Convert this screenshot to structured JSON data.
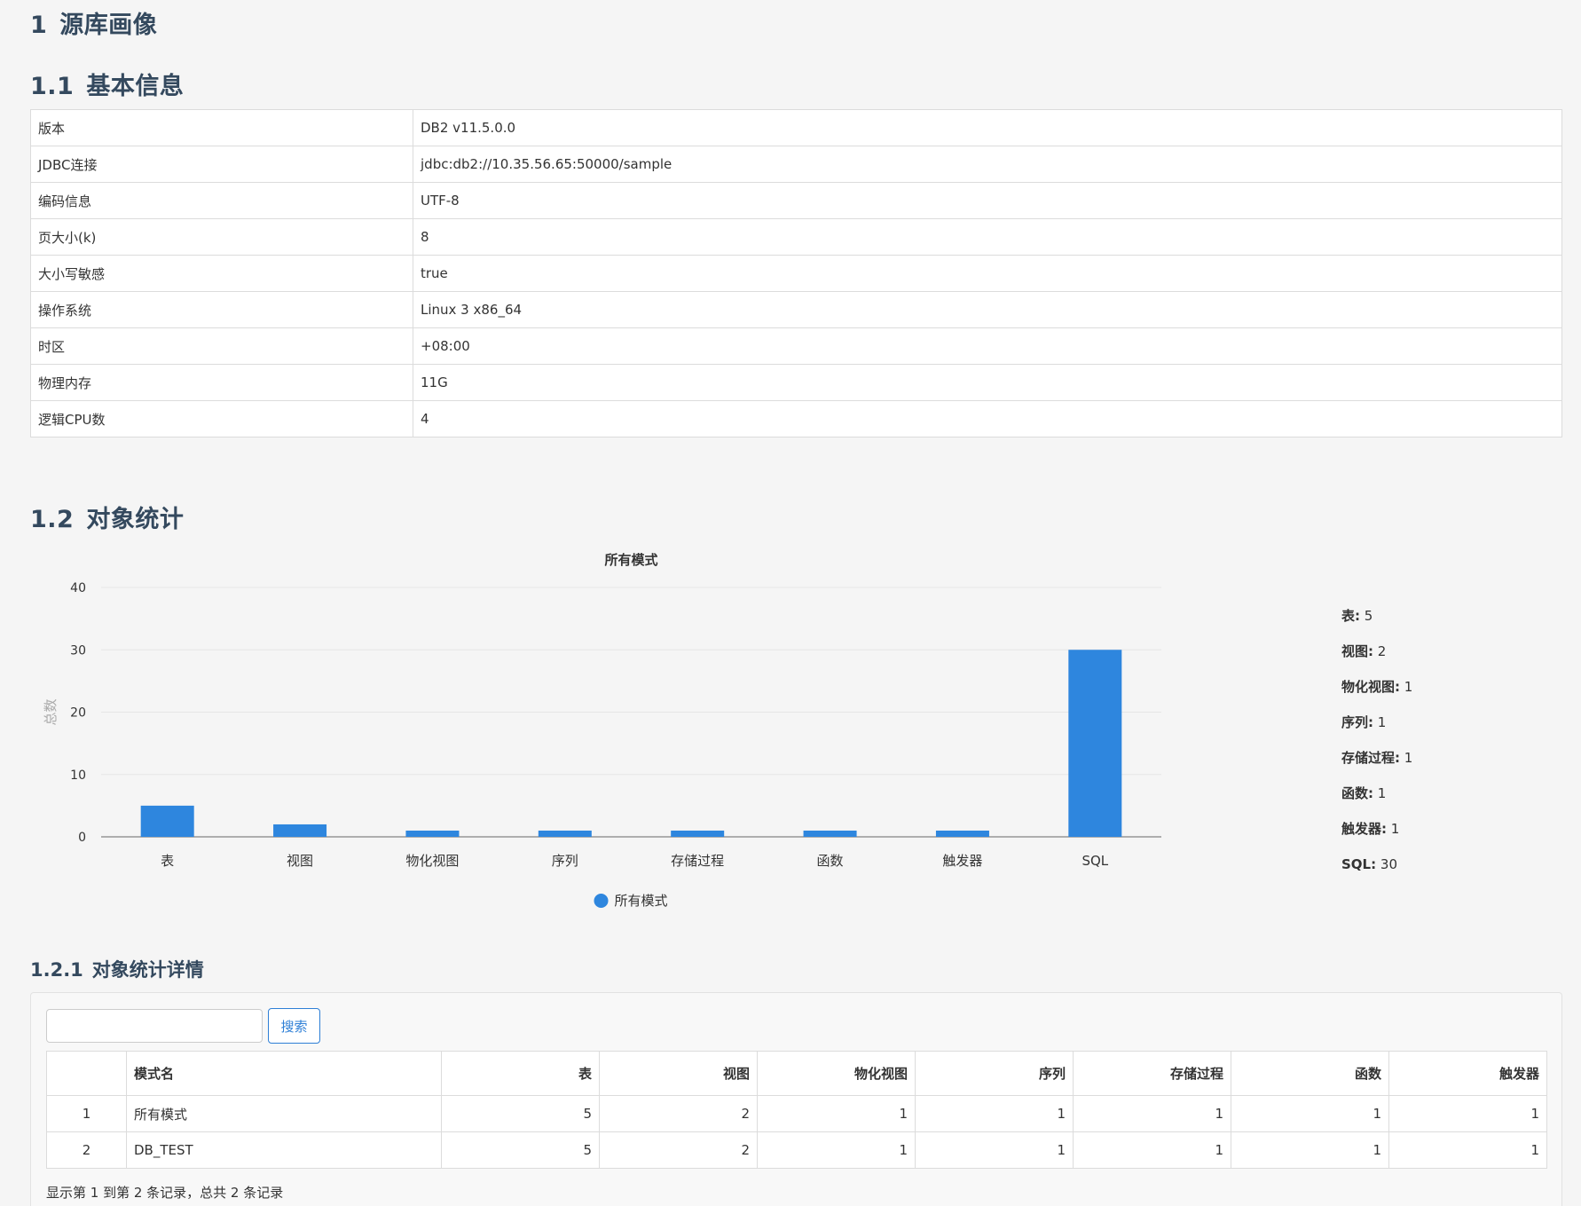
{
  "section": {
    "num": "1",
    "title": "源库画像"
  },
  "basic": {
    "num": "1.1",
    "title": "基本信息",
    "rows": [
      {
        "key": "版本",
        "value": "DB2 v11.5.0.0"
      },
      {
        "key": "JDBC连接",
        "value": "jdbc:db2://10.35.56.65:50000/sample"
      },
      {
        "key": "编码信息",
        "value": "UTF-8"
      },
      {
        "key": "页大小(k)",
        "value": "8"
      },
      {
        "key": "大小写敏感",
        "value": "true"
      },
      {
        "key": "操作系统",
        "value": "Linux 3 x86_64"
      },
      {
        "key": "时区",
        "value": "+08:00"
      },
      {
        "key": "物理内存",
        "value": "11G"
      },
      {
        "key": "逻辑CPU数",
        "value": "4"
      }
    ]
  },
  "stats": {
    "num": "1.2",
    "title": "对象统计",
    "side": [
      {
        "label": "表:",
        "value": "5"
      },
      {
        "label": "视图:",
        "value": "2"
      },
      {
        "label": "物化视图:",
        "value": "1"
      },
      {
        "label": "序列:",
        "value": "1"
      },
      {
        "label": "存储过程:",
        "value": "1"
      },
      {
        "label": "函数:",
        "value": "1"
      },
      {
        "label": "触发器:",
        "value": "1"
      },
      {
        "label": "SQL:",
        "value": "30"
      }
    ]
  },
  "chart_data": {
    "type": "bar",
    "title": "所有模式",
    "categories": [
      "表",
      "视图",
      "物化视图",
      "序列",
      "存储过程",
      "函数",
      "触发器",
      "SQL"
    ],
    "series": [
      {
        "name": "所有模式",
        "values": [
          5,
          2,
          1,
          1,
          1,
          1,
          1,
          30
        ]
      }
    ],
    "xlabel": "",
    "ylabel": "总数",
    "ylim": [
      0,
      40
    ],
    "yticks": [
      0,
      10,
      20,
      30,
      40
    ],
    "grid": true,
    "legend": "bottom",
    "color": "#2e86de"
  },
  "detail": {
    "num": "1.2.1",
    "title": "对象统计详情",
    "search": {
      "button": "搜索",
      "value": ""
    },
    "columns": [
      "",
      "模式名",
      "表",
      "视图",
      "物化视图",
      "序列",
      "存储过程",
      "函数",
      "触发器"
    ],
    "rows": [
      [
        "1",
        "所有模式",
        "5",
        "2",
        "1",
        "1",
        "1",
        "1",
        "1"
      ],
      [
        "2",
        "DB_TEST",
        "5",
        "2",
        "1",
        "1",
        "1",
        "1",
        "1"
      ]
    ],
    "footer": "显示第 1 到第 2 条记录，总共 2 条记录"
  }
}
